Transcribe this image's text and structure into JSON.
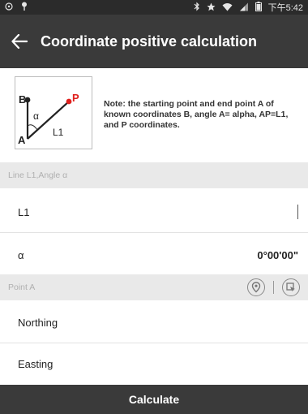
{
  "status_bar": {
    "left_icons": [
      "location-circle-icon",
      "pin-icon"
    ],
    "right_icons": [
      "bluetooth-icon",
      "star-icon",
      "wifi-icon",
      "signal-icon",
      "battery-icon"
    ],
    "time": "下午5:42"
  },
  "header": {
    "back_icon": "back-arrow-icon",
    "title": "Coordinate positive calculation"
  },
  "note": {
    "diagram_labels": {
      "b": "B",
      "a": "A",
      "p": "P",
      "alpha": "α",
      "l1": "L1"
    },
    "text": "Note: the starting point and end point A of known coordinates B, angle A= alpha, AP=L1, and P coordinates."
  },
  "section_line": {
    "label": "Line L1,Angle α"
  },
  "fields": {
    "l1": {
      "label": "L1",
      "value": ""
    },
    "alpha": {
      "label": "α",
      "value": "0°00'00\""
    }
  },
  "section_point_a": {
    "label": "Point A",
    "icons": [
      "map-point-icon",
      "select-point-icon"
    ]
  },
  "point_a_fields": {
    "northing": {
      "label": "Northing",
      "value": ""
    },
    "easting": {
      "label": "Easting",
      "value": ""
    }
  },
  "footer": {
    "calculate_label": "Calculate"
  },
  "colors": {
    "app_bar": "#3a3a3a",
    "section_bg": "#e9e9e9",
    "accent_red": "#e0201d"
  }
}
